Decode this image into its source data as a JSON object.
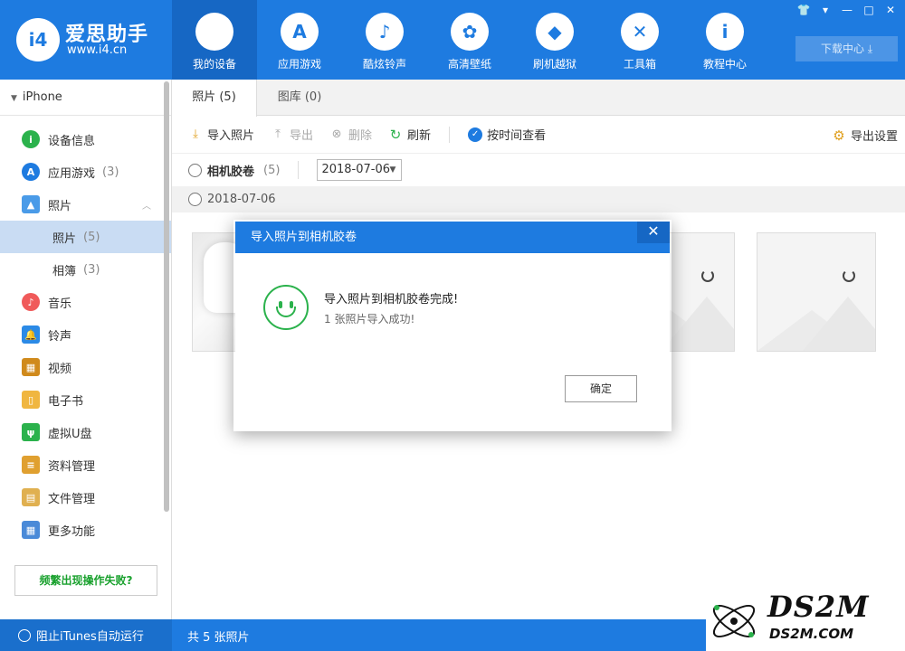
{
  "app": {
    "logo_badge": "i4",
    "logo_name": "爱思助手",
    "logo_url": "www.i4.cn"
  },
  "nav": [
    {
      "label": "我的设备",
      "icon": "apple-icon",
      "glyph": "",
      "active": true
    },
    {
      "label": "应用游戏",
      "icon": "app-store-icon",
      "glyph": "A"
    },
    {
      "label": "酷炫铃声",
      "icon": "bell-icon",
      "glyph": "♪"
    },
    {
      "label": "高清壁纸",
      "icon": "flower-icon",
      "glyph": "✿"
    },
    {
      "label": "刷机越狱",
      "icon": "dropbox-icon",
      "glyph": "◆"
    },
    {
      "label": "工具箱",
      "icon": "tools-icon",
      "glyph": "✕"
    },
    {
      "label": "教程中心",
      "icon": "info-icon",
      "glyph": "i"
    }
  ],
  "window_controls": [
    "👕",
    "▾",
    "—",
    "□",
    "✕"
  ],
  "download_center": "下载中心 ⤓",
  "sidebar": {
    "device": "iPhone",
    "items": [
      {
        "label": "设备信息",
        "icon": "info-circle-icon",
        "color": "#2bb24c",
        "glyph": "i"
      },
      {
        "label": "应用游戏",
        "count": "(3)",
        "icon": "app-store-icon",
        "color": "#1e7be0",
        "glyph": "A"
      },
      {
        "label": "照片",
        "icon": "photo-icon",
        "color": "#4a9be8",
        "glyph": "▲",
        "caret": "︿"
      },
      {
        "label": "照片",
        "count": "(5)",
        "sub": true,
        "selected": true
      },
      {
        "label": "相簿",
        "count": "(3)",
        "sub": true
      },
      {
        "label": "音乐",
        "icon": "music-icon",
        "color": "#f05a5a",
        "glyph": "♪"
      },
      {
        "label": "铃声",
        "icon": "bell-icon",
        "color": "#2b8ae6",
        "glyph": "🔔"
      },
      {
        "label": "视频",
        "icon": "film-icon",
        "color": "#d08a1c",
        "glyph": "▦"
      },
      {
        "label": "电子书",
        "icon": "book-icon",
        "color": "#f0b640",
        "glyph": "▯"
      },
      {
        "label": "虚拟U盘",
        "icon": "usb-icon",
        "color": "#2bb24c",
        "glyph": "ψ"
      },
      {
        "label": "资料管理",
        "icon": "document-icon",
        "color": "#e0a030",
        "glyph": "≡"
      },
      {
        "label": "文件管理",
        "icon": "folder-file-icon",
        "color": "#e0b050",
        "glyph": "▤"
      },
      {
        "label": "更多功能",
        "icon": "grid-icon",
        "color": "#4a8ad8",
        "glyph": "▦"
      }
    ],
    "fail_button": "频繁出现操作失败?"
  },
  "tabs": [
    {
      "label": "照片 (5)",
      "active": true
    },
    {
      "label": "图库 (0)"
    }
  ],
  "toolbar": {
    "import": "导入照片",
    "export": "导出",
    "delete": "删除",
    "refresh": "刷新",
    "by_time": "按时间查看",
    "export_settings": "导出设置"
  },
  "filter": {
    "album": "相机胶卷",
    "album_count": "(5)",
    "date": "2018-07-06"
  },
  "date_group": "2018-07-06",
  "status": {
    "itunes": "阻止iTunes自动运行",
    "count": "共 5 张照片"
  },
  "watermark": {
    "big": "DS2M",
    "small": "DS2M.COM"
  },
  "dialog": {
    "title": "导入照片到相机胶卷",
    "close": "✕",
    "message": "导入照片到相机胶卷完成!",
    "detail": "1 张照片导入成功!",
    "ok": "确定"
  }
}
